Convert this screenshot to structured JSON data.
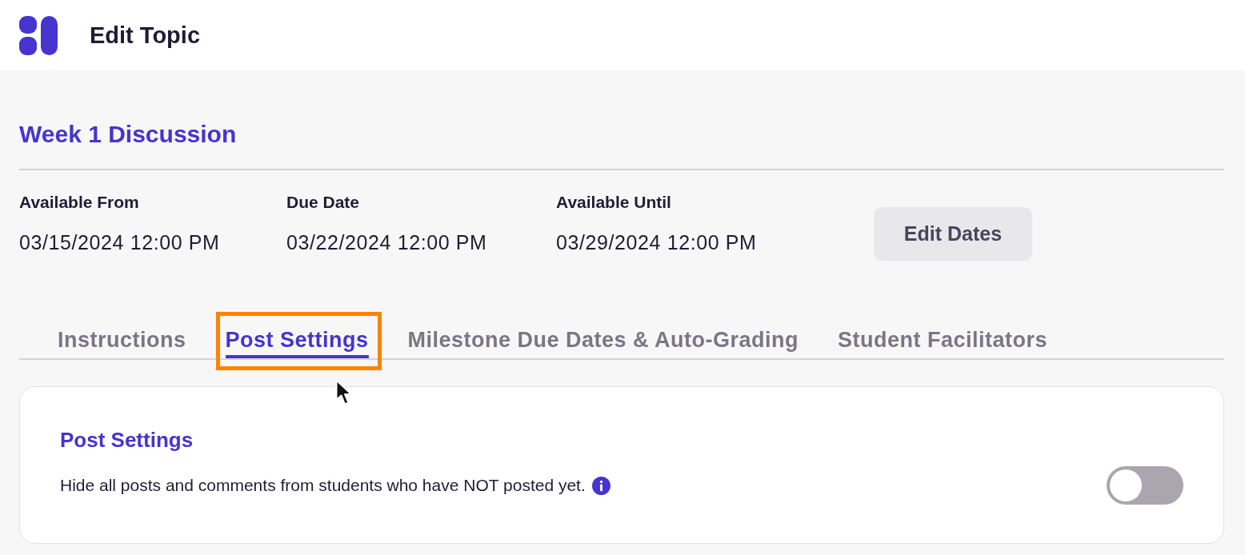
{
  "header": {
    "title": "Edit Topic"
  },
  "topic": {
    "title": "Week 1 Discussion"
  },
  "dates": [
    {
      "label": "Available From",
      "value": "03/15/2024 12:00 PM"
    },
    {
      "label": "Due Date",
      "value": "03/22/2024 12:00 PM"
    },
    {
      "label": "Available Until",
      "value": "03/29/2024 12:00 PM"
    }
  ],
  "edit_dates_button": {
    "label": "Edit Dates"
  },
  "tabs": [
    {
      "label": "Instructions",
      "selected": false,
      "highlighted": false
    },
    {
      "label": "Post Settings",
      "selected": true,
      "highlighted": true
    },
    {
      "label": "Milestone Due Dates & Auto-Grading",
      "selected": false,
      "highlighted": false
    },
    {
      "label": "Student Facilitators",
      "selected": false,
      "highlighted": false
    }
  ],
  "card": {
    "title": "Post Settings",
    "settings": [
      {
        "label": "Hide all posts and comments from students who have NOT posted yet.",
        "info": true,
        "on": false
      }
    ]
  }
}
